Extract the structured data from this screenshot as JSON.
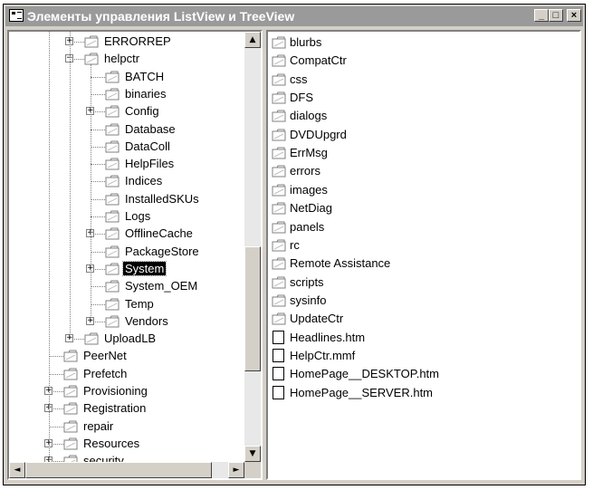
{
  "window": {
    "title": "Элементы управления ListView и TreeView",
    "minimize_label": "_",
    "maximize_label": "□",
    "close_label": "×"
  },
  "tree": {
    "nodes": [
      {
        "label": "ERRORREP",
        "level": 2,
        "expandable": true,
        "selected": false
      },
      {
        "label": "helpctr",
        "level": 2,
        "expandable": true,
        "expanded": true,
        "selected": false
      },
      {
        "label": "BATCH",
        "level": 3,
        "expandable": false,
        "selected": false
      },
      {
        "label": "binaries",
        "level": 3,
        "expandable": false,
        "selected": false
      },
      {
        "label": "Config",
        "level": 3,
        "expandable": true,
        "selected": false
      },
      {
        "label": "Database",
        "level": 3,
        "expandable": false,
        "selected": false
      },
      {
        "label": "DataColl",
        "level": 3,
        "expandable": false,
        "selected": false
      },
      {
        "label": "HelpFiles",
        "level": 3,
        "expandable": false,
        "selected": false
      },
      {
        "label": "Indices",
        "level": 3,
        "expandable": false,
        "selected": false
      },
      {
        "label": "InstalledSKUs",
        "level": 3,
        "expandable": false,
        "selected": false
      },
      {
        "label": "Logs",
        "level": 3,
        "expandable": false,
        "selected": false
      },
      {
        "label": "OfflineCache",
        "level": 3,
        "expandable": true,
        "selected": false
      },
      {
        "label": "PackageStore",
        "level": 3,
        "expandable": false,
        "selected": false
      },
      {
        "label": "System",
        "level": 3,
        "expandable": true,
        "selected": true
      },
      {
        "label": "System_OEM",
        "level": 3,
        "expandable": false,
        "selected": false
      },
      {
        "label": "Temp",
        "level": 3,
        "expandable": false,
        "selected": false
      },
      {
        "label": "Vendors",
        "level": 3,
        "expandable": true,
        "selected": false
      },
      {
        "label": "UploadLB",
        "level": 2,
        "expandable": true,
        "selected": false
      },
      {
        "label": "PeerNet",
        "level": 1,
        "expandable": false,
        "selected": false
      },
      {
        "label": "Prefetch",
        "level": 1,
        "expandable": false,
        "selected": false
      },
      {
        "label": "Provisioning",
        "level": 1,
        "expandable": true,
        "selected": false
      },
      {
        "label": "Registration",
        "level": 1,
        "expandable": true,
        "selected": false
      },
      {
        "label": "repair",
        "level": 1,
        "expandable": false,
        "selected": false
      },
      {
        "label": "Resources",
        "level": 1,
        "expandable": true,
        "selected": false
      },
      {
        "label": "security",
        "level": 1,
        "expandable": true,
        "selected": false
      }
    ],
    "scroll_up_icon": "▲",
    "scroll_down_icon": "▼",
    "scroll_left_icon": "◄",
    "scroll_right_icon": "►"
  },
  "list": {
    "items": [
      {
        "label": "blurbs",
        "icon": "folder-icon"
      },
      {
        "label": "CompatCtr",
        "icon": "folder-icon"
      },
      {
        "label": "css",
        "icon": "folder-icon"
      },
      {
        "label": "DFS",
        "icon": "folder-icon"
      },
      {
        "label": "dialogs",
        "icon": "folder-icon"
      },
      {
        "label": "DVDUpgrd",
        "icon": "folder-icon"
      },
      {
        "label": "ErrMsg",
        "icon": "folder-icon"
      },
      {
        "label": "errors",
        "icon": "folder-icon"
      },
      {
        "label": "images",
        "icon": "folder-icon"
      },
      {
        "label": "NetDiag",
        "icon": "folder-icon"
      },
      {
        "label": "panels",
        "icon": "folder-icon"
      },
      {
        "label": "rc",
        "icon": "folder-icon"
      },
      {
        "label": "Remote Assistance",
        "icon": "folder-icon"
      },
      {
        "label": "scripts",
        "icon": "folder-icon"
      },
      {
        "label": "sysinfo",
        "icon": "folder-icon"
      },
      {
        "label": "UpdateCtr",
        "icon": "folder-icon"
      },
      {
        "label": "Headlines.htm",
        "icon": "file-icon"
      },
      {
        "label": "HelpCtr.mmf",
        "icon": "file-icon"
      },
      {
        "label": "HomePage__DESKTOP.htm",
        "icon": "file-icon"
      },
      {
        "label": "HomePage__SERVER.htm",
        "icon": "file-icon"
      }
    ]
  },
  "colors": {
    "titlebar": "#9a9a9a",
    "face": "#d4d0c8",
    "selection": "#000000"
  }
}
